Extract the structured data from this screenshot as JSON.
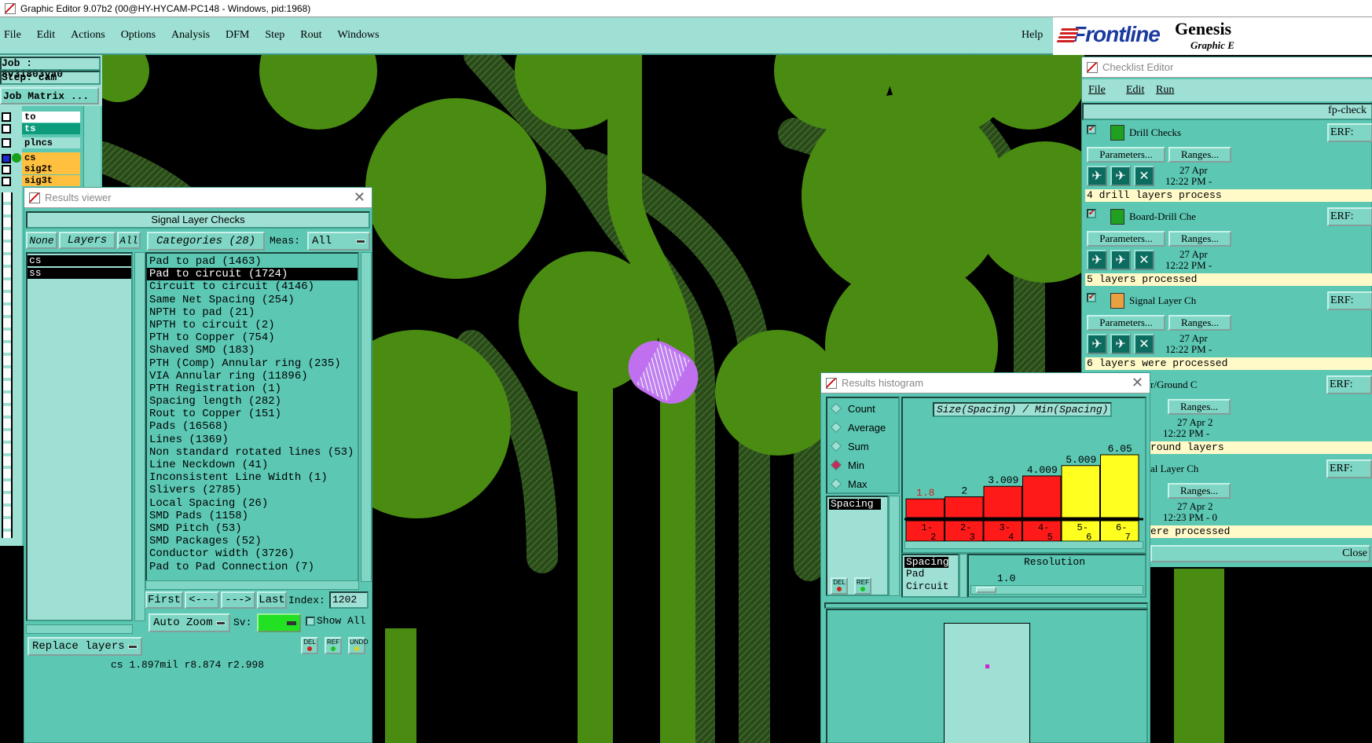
{
  "window_title": "Graphic Editor 9.07b2 (00@HY-HYCAM-PC148 - Windows, pid:1968)",
  "menu": [
    "File",
    "Edit",
    "Actions",
    "Options",
    "Analysis",
    "DFM",
    "Step",
    "Rout",
    "Windows"
  ],
  "help": "Help",
  "brand": {
    "logo": "Frontline",
    "product": "Genesis",
    "sub": "Graphic E"
  },
  "job": {
    "job": "Job : 8v31803ya0",
    "step": "Step: cam",
    "matrix": "Job Matrix ..."
  },
  "layers": [
    "to",
    "ts",
    "plncs",
    "cs",
    "sig2t",
    "sig3t"
  ],
  "results_viewer": {
    "title": "Results viewer",
    "header": "Signal Layer Checks",
    "none": "None",
    "layers_label": "Layers",
    "all": "All",
    "categories_label": "Categories (28)",
    "meas_label": "Meas:",
    "meas_value": "All",
    "layer_list": [
      "cs",
      "ss"
    ],
    "categories": [
      "Pad to pad (1463)",
      "Pad to circuit (1724)",
      "Circuit to circuit (4146)",
      "Same Net Spacing (254)",
      "NPTH to pad (21)",
      "NPTH to circuit (2)",
      "PTH to Copper (754)",
      "Shaved SMD (183)",
      "PTH (Comp) Annular ring (235)",
      "VIA Annular ring (11896)",
      "PTH Registration (1)",
      "Spacing length (282)",
      "Rout to Copper (151)",
      "Pads (16568)",
      "Lines (1369)",
      "Non standard rotated lines (53)",
      "Line Neckdown (41)",
      "Inconsistent Line Width (1)",
      "Slivers (2785)",
      "Local Spacing (26)",
      "SMD Pads (1158)",
      "SMD Pitch (53)",
      "SMD Packages (52)",
      "Conductor width (3726)",
      "Pad to Pad Connection (7)"
    ],
    "nav": {
      "first": "First",
      "prev": "<---",
      "next": "--->",
      "last": "Last",
      "index_label": "Index:",
      "index_value": "1202"
    },
    "auto_zoom": "Auto Zoom",
    "sv_label": "Sv:",
    "show_all": "Show All",
    "replace_layers": "Replace layers",
    "del": "DEL",
    "ref": "REF",
    "undo": "UNDO",
    "status": "cs 1.897mil r8.874 r2.998"
  },
  "checklist": {
    "title": "Checklist Editor",
    "menu": [
      "File",
      "Edit",
      "Run"
    ],
    "name": "fp-check",
    "erf": "ERF:",
    "params": "Parameters...",
    "ranges": "Ranges...",
    "checks": [
      {
        "name": "Drill Checks",
        "date": "27 Apr",
        "time": "12:22 PM -",
        "status": "4 drill layers process"
      },
      {
        "name": "Board-Drill Che",
        "date": "27 Apr",
        "time": "12:22 PM -",
        "status": "5 layers processed"
      },
      {
        "name": "Signal Layer Ch",
        "date": "27 Apr",
        "time": "12:22 PM -",
        "status": "6 layers were processed"
      }
    ],
    "partial": [
      {
        "name": "r/Ground C",
        "date": "27 Apr 2",
        "time": "12:22 PM -",
        "status": "round layers"
      },
      {
        "name": "al Layer Ch",
        "date": "27 Apr 2",
        "time": "12:23 PM - 0",
        "status": "ere processed"
      }
    ],
    "close": "Close"
  },
  "histogram": {
    "title": "Results histogram",
    "modes": [
      "Count",
      "Average",
      "Sum",
      "Min",
      "Max"
    ],
    "selected_mode": "Min",
    "measure": "Spacing",
    "chart_title": "Size(Spacing) / Min(Spacing)",
    "bins": [
      "1-2",
      "2-3",
      "3-4",
      "4-5",
      "5-6",
      "6-7"
    ],
    "values": [
      1.8,
      2,
      3.009,
      4.009,
      5.009,
      6.05
    ],
    "value_labels": [
      "1.8",
      "2",
      "3.009",
      "4.009",
      "5.009",
      "6.05"
    ],
    "bin_colors": [
      "#ff1a1a",
      "#ff1a1a",
      "#ff1a1a",
      "#ff1a1a",
      "#ffff20",
      "#ffff20"
    ],
    "types": [
      "Spacing",
      "Pad",
      "Circuit"
    ],
    "resolution_label": "Resolution",
    "resolution_value": "1.0",
    "del": "DEL",
    "ref": "REF"
  }
}
